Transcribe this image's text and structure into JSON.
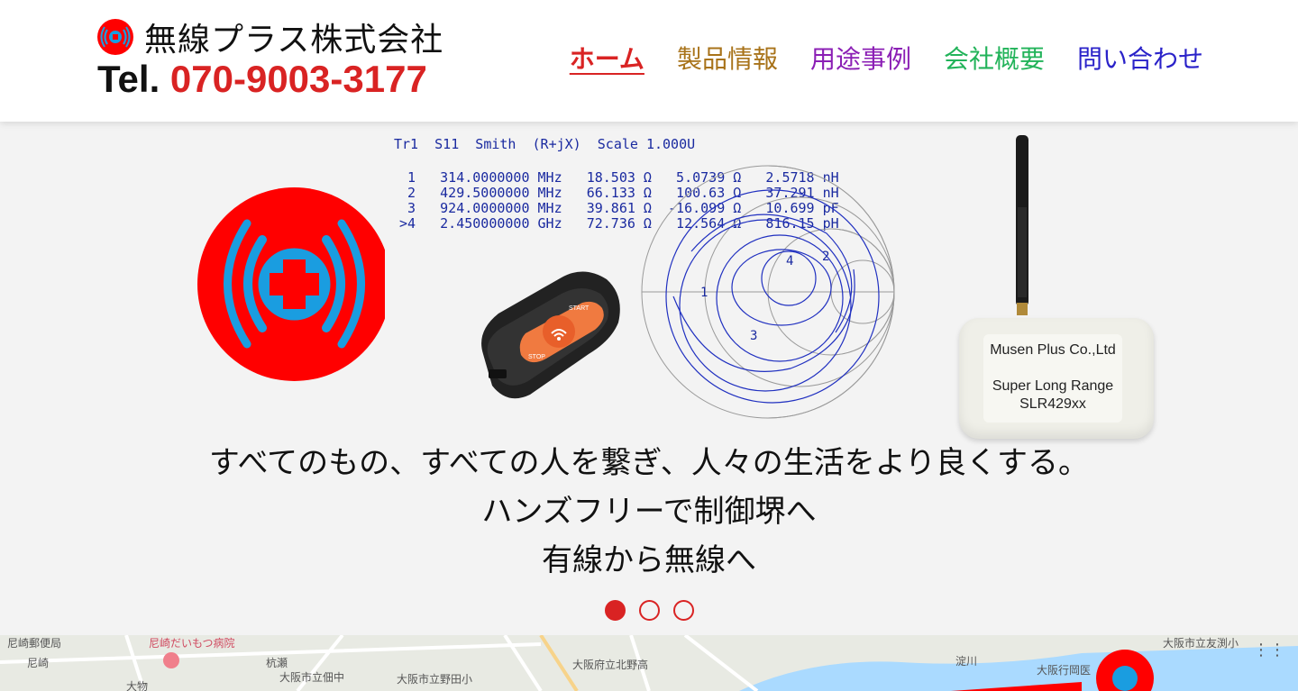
{
  "header": {
    "brand_name": "無線プラス株式会社",
    "tel_label": "Tel.",
    "tel_number": "070-9003-3177",
    "logo_icon": "radio-signal-icon"
  },
  "nav": {
    "items": [
      {
        "label": "ホーム",
        "color": "#d92323",
        "active": true
      },
      {
        "label": "製品情報",
        "color": "#a8731a",
        "active": false
      },
      {
        "label": "用途事例",
        "color": "#8b1fb5",
        "active": false
      },
      {
        "label": "会社概要",
        "color": "#22b35a",
        "active": false
      },
      {
        "label": "問い合わせ",
        "color": "#2a22c9",
        "active": false
      }
    ]
  },
  "hero": {
    "smith": {
      "header": "Tr1  S11  Smith  (R+jX)  Scale 1.000U",
      "rows": [
        " 1   314.0000000 MHz   18.503 Ω   5.0739 Ω   2.5718 nH",
        " 2   429.5000000 MHz   66.133 Ω   100.63 Ω   37.291 nH",
        " 3   924.0000000 MHz   39.861 Ω  -16.099 Ω   10.699 pF",
        ">4   2.450000000 GHz   72.736 Ω   12.564 Ω   816.15 pH"
      ],
      "markers": [
        "1",
        "2",
        "3",
        "4"
      ]
    },
    "device": {
      "line1": "Musen Plus Co.,Ltd",
      "line2": "Super Long Range",
      "line3": "SLR429xx"
    },
    "remote": {
      "top_label": "START",
      "bottom_label": "STOP"
    },
    "tagline": [
      "すべてのもの、すべての人を繋ぎ、人々の生活をより良くする。",
      "ハンズフリーで制御堺へ",
      "有線から無線へ"
    ],
    "slides": {
      "count": 3,
      "active_index": 0
    },
    "colors": {
      "brand_red": "#d92323",
      "logo_red": "#ff0000",
      "logo_blue": "#1a9de0",
      "smith_blue": "#1a2aa0"
    }
  },
  "map": {
    "labels": [
      "尼崎郵便局",
      "尼崎だいもつ病院",
      "杭瀬",
      "大阪市立佃中",
      "尼崎",
      "大阪市立野田小",
      "淀川",
      "大阪行岡医",
      "大阪市立友渕小",
      "大物",
      "大阪府立北野高"
    ]
  }
}
